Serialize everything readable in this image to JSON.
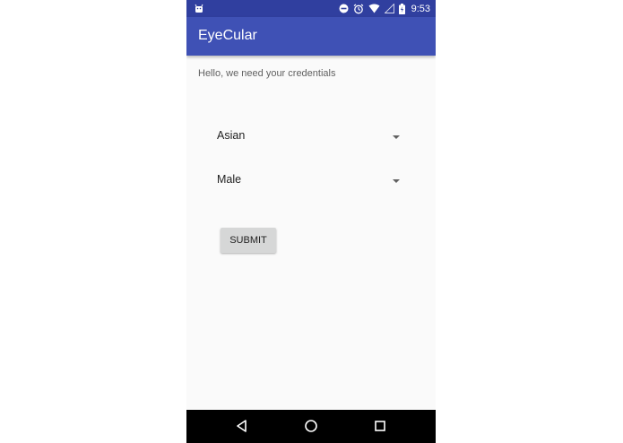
{
  "status_bar": {
    "time": "9:53",
    "left_icon": "android-icon",
    "right_icons": [
      "do-not-disturb-icon",
      "alarm-icon",
      "wifi-icon",
      "no-signal-icon",
      "battery-charging-icon"
    ]
  },
  "app_bar": {
    "title": "EyeCular"
  },
  "form": {
    "prompt": "Hello, we need your credentials",
    "ethnicity_value": "Asian",
    "gender_value": "Male",
    "submit_label": "SUBMIT"
  },
  "nav_bar": {
    "icons": [
      "back-icon",
      "home-icon",
      "recents-icon"
    ]
  },
  "colors": {
    "status_bar": "#303f9f",
    "app_bar": "#3f51b5",
    "background": "#fafafa",
    "button": "#d6d7d7"
  }
}
